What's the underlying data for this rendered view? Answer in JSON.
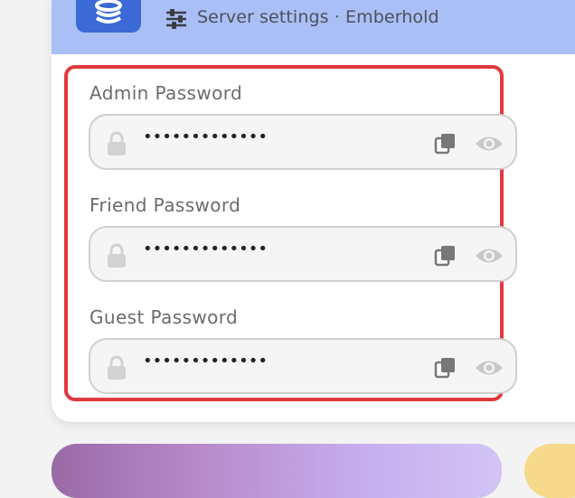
{
  "header": {
    "title": "Server settings · Emberhold",
    "app_icon": "server-app-icon",
    "settings_icon": "sliders-icon"
  },
  "passwords": [
    {
      "label": "Admin Password",
      "masked_value": "•••••••••••••"
    },
    {
      "label": "Friend Password",
      "masked_value": "•••••••••••••"
    },
    {
      "label": "Guest Password",
      "masked_value": "•••••••••••••"
    }
  ],
  "icons": {
    "lock": "lock-icon",
    "copy": "copy-icon",
    "reveal": "eye-icon"
  },
  "colors": {
    "header_bg": "#a9bff5",
    "app_icon_bg": "#3b6ad6",
    "highlight_border": "#e0393e",
    "field_bg": "#f5f5f5"
  }
}
